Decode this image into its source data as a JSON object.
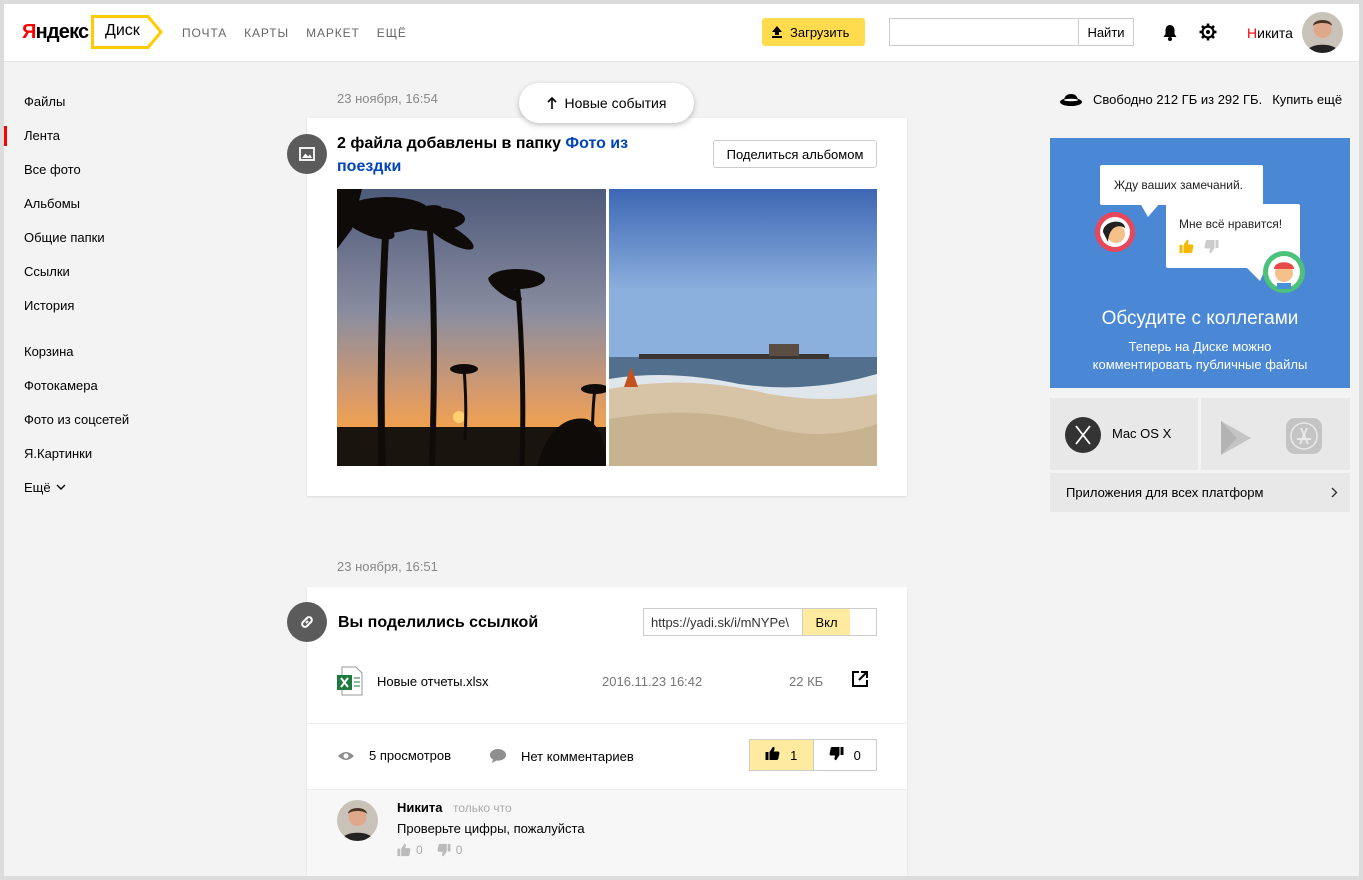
{
  "header": {
    "logo": {
      "first": "Я",
      "rest": "ндекс"
    },
    "disk_tab": "Диск",
    "nav": [
      "ПОЧТА",
      "КАРТЫ",
      "МАРКЕТ",
      "ЕЩЁ"
    ],
    "upload_label": "Загрузить",
    "search": {
      "value": "",
      "button": "Найти"
    },
    "user": {
      "first": "Н",
      "rest": "икита"
    }
  },
  "sidebar": {
    "group1": [
      {
        "label": "Файлы",
        "active": false
      },
      {
        "label": "Лента",
        "active": true
      },
      {
        "label": "Все фото",
        "active": false
      },
      {
        "label": "Альбомы",
        "active": false
      },
      {
        "label": "Общие папки",
        "active": false
      },
      {
        "label": "Ссылки",
        "active": false
      },
      {
        "label": "История",
        "active": false
      }
    ],
    "group2": [
      "Корзина",
      "Фотокамера",
      "Фото из соцсетей",
      "Я.Картинки"
    ],
    "more": "Ещё"
  },
  "feed": {
    "new_events": "Новые события",
    "event1": {
      "date": "23 ноября, 16:54",
      "title_prefix": "2 файла добавлены в папку ",
      "title_link": "Фото из поездки",
      "share_button": "Поделиться альбомом"
    },
    "event2": {
      "date": "23 ноября, 16:51",
      "title": "Вы поделились ссылкой",
      "link_url": "https://yadi.sk/i/mNYPe\\",
      "toggle_label": "Вкл",
      "file": {
        "name": "Новые отчеты.xlsx",
        "date": "2016.11.23 16:42",
        "size": "22 КБ"
      },
      "views": "5 просмотров",
      "comments_status": "Нет комментариев",
      "likes": "1",
      "dislikes": "0",
      "comment": {
        "author": "Никита",
        "time": "только что",
        "text": "Проверьте цифры, пожалуйста",
        "likes": "0",
        "dislikes": "0"
      }
    }
  },
  "right": {
    "space": {
      "text": "Свободно 212 ГБ из 292 ГБ.",
      "buy": "Купить ещё"
    },
    "promo": {
      "bubble1": "Жду ваших замечаний.",
      "bubble2": "Мне всё нравится!",
      "title": "Обсудите с коллегами",
      "subtitle_line1": "Теперь на Диске можно",
      "subtitle_line2": "комментировать публичные файлы"
    },
    "apps": {
      "mac_label": "Mac OS X",
      "all_platforms": "Приложения для всех платформ"
    }
  },
  "colors": {
    "accent_yellow": "#ffdb4d",
    "brand_red": "#ff0000",
    "link_blue": "#0044bb",
    "promo_blue": "#4a88d6"
  }
}
